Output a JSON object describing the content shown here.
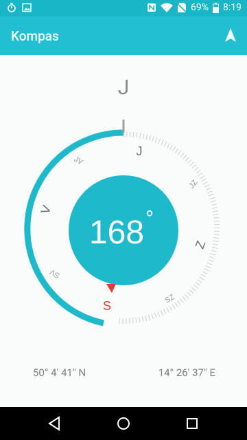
{
  "status_bar": {
    "icons": [
      "timer-icon",
      "image-icon",
      "nfc-icon",
      "wifi-icon",
      "no-sim-icon",
      "battery-icon"
    ],
    "battery": "69%",
    "time": "8:19"
  },
  "app_bar": {
    "title": "Kompas",
    "action_icon": "navigation-arrow-icon"
  },
  "compass": {
    "heading_direction": "J",
    "degrees": "168",
    "degree_symbol": "°",
    "ring_labels": {
      "j": "J",
      "jz": "JZ",
      "z": "Z",
      "sz": "SZ",
      "s": "S",
      "sv": "SV",
      "v": "V",
      "jv": "JV"
    },
    "marker_color": "#e53935",
    "accent_color": "#1fb9cc"
  },
  "location": {
    "latitude": "50° 4' 41\" N",
    "longitude": "14° 26' 37\" E"
  },
  "nav_bar": {
    "back_icon": "back-triangle-icon",
    "home_icon": "home-circle-icon",
    "recents_icon": "recents-square-icon"
  }
}
